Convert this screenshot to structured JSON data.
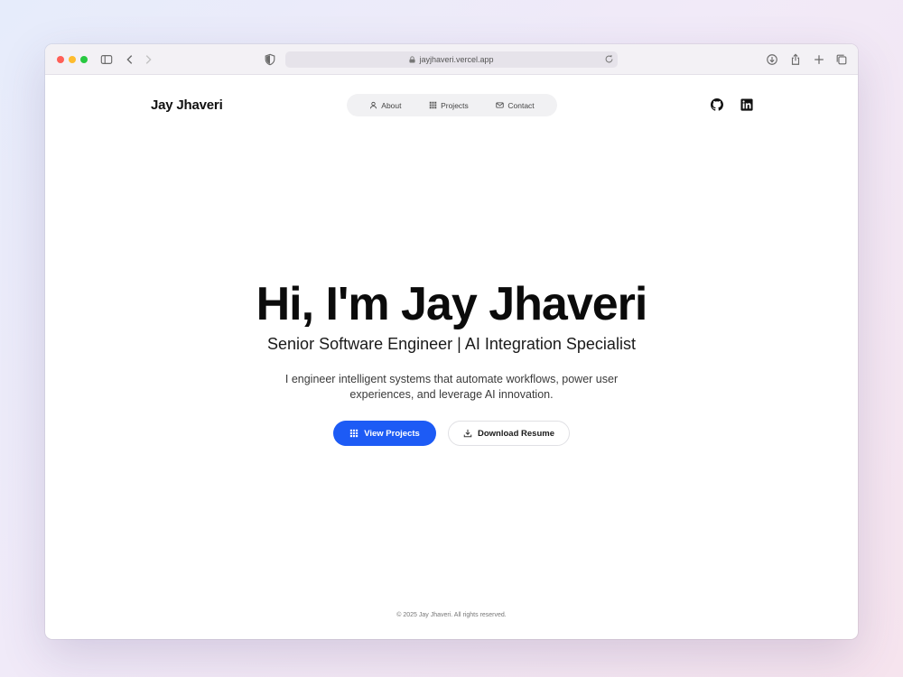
{
  "browser": {
    "url": "jayjhaveri.vercel.app",
    "traffic_lights": [
      "#ff5f57",
      "#febc2e",
      "#28c840"
    ]
  },
  "site": {
    "logo": "Jay Jhaveri",
    "nav": [
      {
        "label": "About",
        "icon": "user-icon"
      },
      {
        "label": "Projects",
        "icon": "grid-icon"
      },
      {
        "label": "Contact",
        "icon": "mail-icon"
      }
    ],
    "social": [
      "github-icon",
      "linkedin-icon"
    ]
  },
  "hero": {
    "title": "Hi, I'm Jay Jhaveri",
    "subtitle": "Senior Software Engineer | AI Integration Specialist",
    "description": "I engineer intelligent systems that automate workflows, power user experiences, and leverage AI innovation.",
    "primary_button": "View Projects",
    "secondary_button": "Download Resume"
  },
  "footer": {
    "text": "© 2025 Jay Jhaveri. All rights reserved."
  },
  "colors": {
    "accent": "#1d5bf5",
    "text": "#0b0b0b"
  }
}
